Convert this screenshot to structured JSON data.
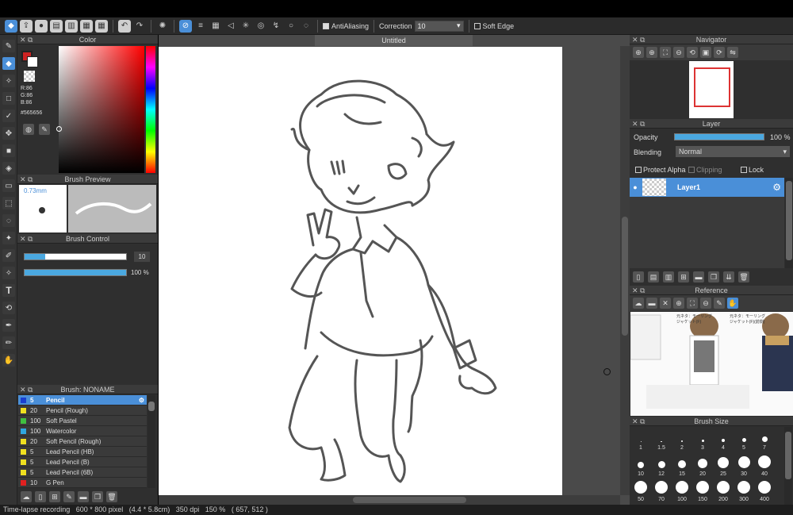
{
  "toolbar": {
    "antialiasing_label": "AntiAliasing",
    "correction_label": "Correction",
    "correction_value": "10",
    "soft_edge_label": "Soft Edge"
  },
  "canvas": {
    "tab_title": "Untitled"
  },
  "color_panel": {
    "title": "Color",
    "r": "R:86",
    "g": "G:86",
    "b": "B:86",
    "hex": "#565656",
    "current_color": "#565656",
    "fg_color": "#cc2222"
  },
  "brush_preview": {
    "title": "Brush Preview",
    "size": "0.73mm"
  },
  "brush_control": {
    "title": "Brush Control",
    "size_value": "10",
    "opacity_value": "100 %",
    "size_fraction": 0.2,
    "opacity_fraction": 1.0
  },
  "brush_list": {
    "title": "Brush: NONAME",
    "items": [
      {
        "size": "5",
        "name": "Pencil",
        "color": "#1a3fd0"
      },
      {
        "size": "20",
        "name": "Pencil (Rough)",
        "color": "#f0e020"
      },
      {
        "size": "100",
        "name": "Soft Pastel",
        "color": "#40c040"
      },
      {
        "size": "100",
        "name": "Watercolor",
        "color": "#30a8e0"
      },
      {
        "size": "20",
        "name": "Soft Pencil (Rough)",
        "color": "#f0e020"
      },
      {
        "size": "5",
        "name": "Lead Pencil (HB)",
        "color": "#f0e020"
      },
      {
        "size": "5",
        "name": "Lead Pencil (B)",
        "color": "#f0e020"
      },
      {
        "size": "5",
        "name": "Lead Pencil (6B)",
        "color": "#f0e020"
      },
      {
        "size": "10",
        "name": "G Pen",
        "color": "#e02020"
      }
    ]
  },
  "navigator": {
    "title": "Navigator"
  },
  "layer": {
    "title": "Layer",
    "opacity_label": "Opacity",
    "opacity_value": "100 %",
    "blending_label": "Blending",
    "blending_value": "Normal",
    "protect_alpha": "Protect Alpha",
    "clipping": "Clipping",
    "lock": "Lock",
    "layer_name": "Layer1"
  },
  "reference": {
    "title": "Reference",
    "jp_text_1": "元ネタ：モーリング\nジャケット(F)",
    "jp_text_2": "元ネタ：モーリング\nジャケット(F)(前側)"
  },
  "brush_size": {
    "title": "Brush Size",
    "sizes": [
      "1",
      "1.5",
      "2",
      "3",
      "4",
      "5",
      "7",
      "10",
      "12",
      "15",
      "20",
      "25",
      "30",
      "40",
      "50",
      "70",
      "100",
      "150",
      "200",
      "300",
      "400"
    ]
  },
  "status": {
    "text": "Time-lapse recording   600 * 800 pixel   (4.4 * 5.8cm)   350 dpi   150 %   ( 657, 512 )"
  }
}
